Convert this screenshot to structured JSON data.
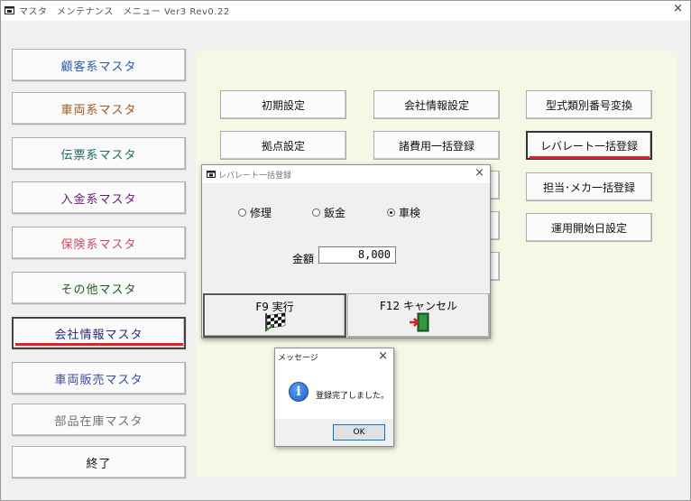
{
  "window": {
    "title": "マスタ　メンテナンス　メニュー Ver3 Rev0.22",
    "close": "×"
  },
  "left_menu": [
    {
      "label": "顧客系マスタ",
      "color": "#2a5aa8"
    },
    {
      "label": "車両系マスタ",
      "color": "#a0581c"
    },
    {
      "label": "伝票系マスタ",
      "color": "#1d6a63"
    },
    {
      "label": "入金系マスタ",
      "color": "#6d1a7a"
    },
    {
      "label": "保険系マスタ",
      "color": "#c94b64"
    },
    {
      "label": "その他マスタ",
      "color": "#1b5e20"
    },
    {
      "label": "会社情報マスタ",
      "color": "#2a2a7a"
    },
    {
      "label": "車両販売マスタ",
      "color": "#3a4aa0"
    },
    {
      "label": "部品在庫マスタ",
      "color": "#707070"
    },
    {
      "label": "終了",
      "color": "#111111"
    }
  ],
  "grid_buttons": {
    "col1": [
      "初期設定",
      "拠点設定"
    ],
    "col2": [
      "会社情報設定",
      "諸費用一括登録"
    ],
    "col3": [
      "型式類別番号変換",
      "レバレート一括登録",
      "担当･メカ一括登録",
      "運用開始日設定"
    ]
  },
  "dialog": {
    "title": "レバレート一括登録",
    "close": "×",
    "radios": [
      {
        "label": "修理",
        "checked": false
      },
      {
        "label": "鈑金",
        "checked": false
      },
      {
        "label": "車検",
        "checked": true
      }
    ],
    "amount_label": "金額",
    "amount_value": "8,000",
    "exec_label": "F9 実行",
    "cancel_label": "F12 キャンセル"
  },
  "message": {
    "title": "メッセージ",
    "close": "×",
    "icon": "info-icon",
    "icon_glyph": "i",
    "text": "登録完了しました。",
    "ok": "OK"
  },
  "accent": {
    "highlight_underline": "#e0222a",
    "panel_bg": "#f6f7e4"
  }
}
